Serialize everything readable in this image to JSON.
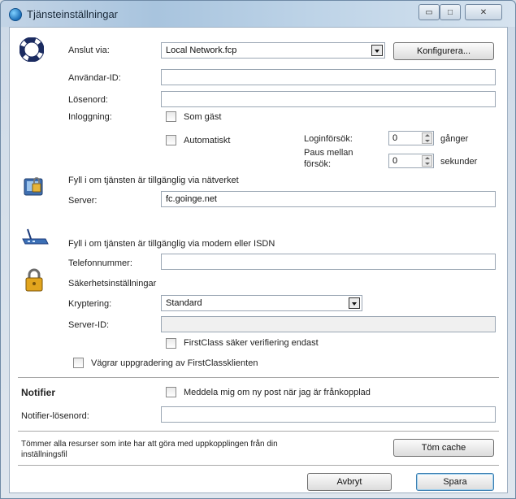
{
  "window": {
    "title": "Tjänsteinställningar",
    "min_glyph": "▭",
    "max_glyph": "□",
    "close_glyph": "✕"
  },
  "connection": {
    "anslut_label": "Anslut via:",
    "anslut_value": "Local Network.fcp",
    "configure_button": "Konfigurera...",
    "user_id_label": "Användar-ID:",
    "user_id_value": "",
    "password_label": "Lösenord:",
    "password_value": "",
    "login_label": "Inloggning:",
    "guest_label": "Som gäst",
    "auto_label": "Automatiskt",
    "login_attempts_label": "Loginförsök:",
    "login_attempts_value": "0",
    "login_attempts_unit": "gånger",
    "pause_label_1": "Paus mellan",
    "pause_label_2": "försök:",
    "pause_value": "0",
    "pause_unit": "sekunder"
  },
  "network": {
    "heading": "Fyll i om tjänsten är tillgänglig via nätverket",
    "server_label": "Server:",
    "server_value": "fc.goinge.net"
  },
  "modem": {
    "heading": "Fyll i om tjänsten är tillgänglig via modem eller ISDN",
    "phone_label": "Telefonnummer:",
    "phone_value": ""
  },
  "security": {
    "heading": "Säkerhetsinställningar",
    "encryption_label": "Kryptering:",
    "encryption_value": "Standard",
    "server_id_label": "Server-ID:",
    "server_id_value": "",
    "secure_verify_label": "FirstClass säker verifiering endast",
    "refuse_upgrade_label": "Vägrar uppgradering av FirstClassklienten"
  },
  "notifier": {
    "heading": "Notifier",
    "notify_label": "Meddela mig om ny post när jag är frånkopplad",
    "password_label": "Notifier-lösenord:",
    "password_value": ""
  },
  "cache": {
    "description_1": "Tömmer alla resurser som inte har att göra med uppkopplingen från din",
    "description_2": "inställningsfil",
    "button": "Töm cache"
  },
  "footer": {
    "cancel_button": "Avbryt",
    "save_button": "Spara"
  }
}
